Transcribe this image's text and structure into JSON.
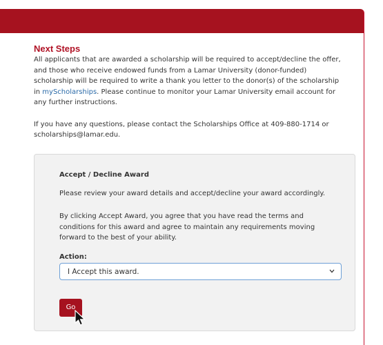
{
  "next_steps": {
    "title": "Next Steps",
    "para1_lines": [
      "All applicants that are awarded a scholarship will be required to accept/decline the offer,",
      "and those who receive endowed funds from a Lamar University (donor-funded)",
      "scholarship will be required to write a thank you letter to the donor(s) of the scholarship"
    ],
    "para1_line4_before": "in ",
    "para1_link": "myScholarships",
    "para1_line4_after": ". Please continue to monitor your Lamar University email account for",
    "para1_line5": "any further instructions.",
    "para2_line1": "If you have any questions, please contact the Scholarships Office at 409-880-1714 or",
    "para2_line2": "scholarships@lamar.edu."
  },
  "award": {
    "title": "Accept / Decline Award",
    "text1": "Please review your award details and accept/decline your award accordingly.",
    "text2_lines": [
      "By clicking Accept Award, you agree that you have read the terms and",
      "conditions for this award and agree to maintain any requirements moving",
      "forward to the best of your ability."
    ],
    "action_label": "Action:",
    "action_value": "I Accept this award.",
    "go_label": "Go"
  },
  "colors": {
    "brand_red": "#a6121f",
    "link_blue": "#2a6aa8"
  },
  "icons": [
    "chevron-down-icon",
    "mouse-pointer-icon"
  ]
}
